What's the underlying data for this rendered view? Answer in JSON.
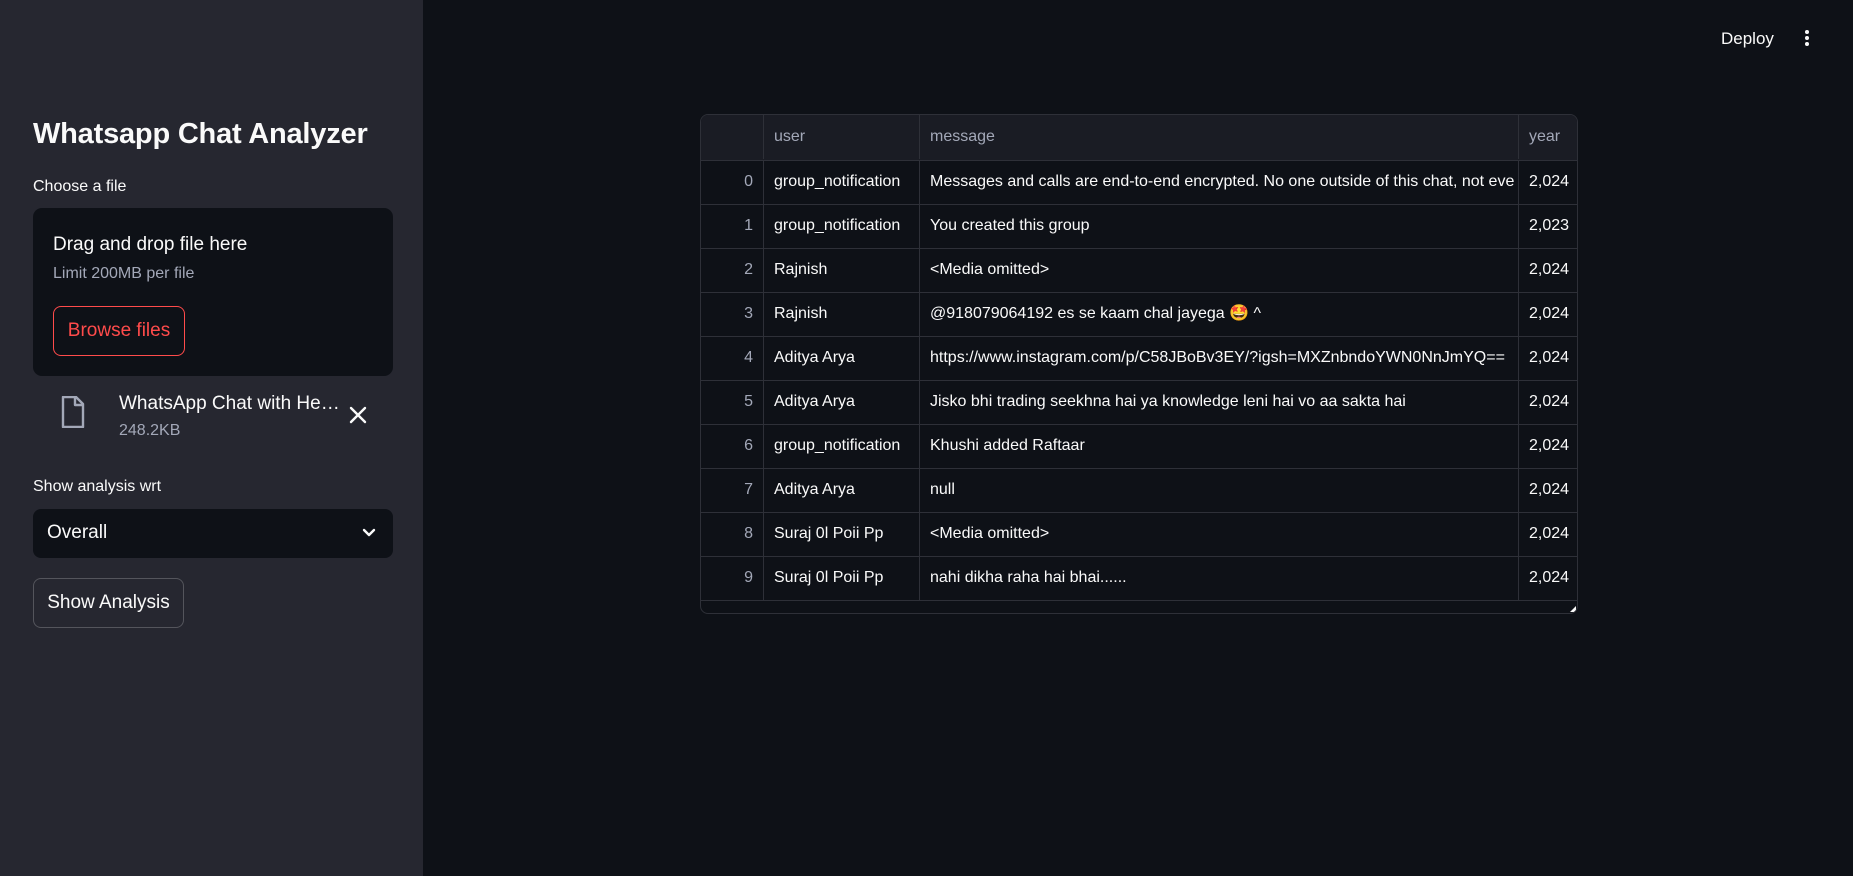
{
  "sidebar": {
    "title": "Whatsapp Chat Analyzer",
    "uploader": {
      "label": "Choose a file",
      "drop_title": "Drag and drop file here",
      "limit": "Limit 200MB per file",
      "browse_label": "Browse files"
    },
    "file": {
      "name": "WhatsApp Chat with Hehe.txt",
      "size": "248.2KB"
    },
    "select": {
      "label": "Show analysis wrt",
      "value": "Overall"
    },
    "show_button": "Show Analysis"
  },
  "header": {
    "deploy": "Deploy"
  },
  "table": {
    "columns": [
      "",
      "user",
      "message",
      "year"
    ],
    "rows": [
      {
        "index": "0",
        "user": "group_notification",
        "message": "Messages and calls are end-to-end encrypted. No one outside of this chat, not eve",
        "year": "2,024"
      },
      {
        "index": "1",
        "user": "group_notification",
        "message": "You created this group",
        "year": "2,023"
      },
      {
        "index": "2",
        "user": "Rajnish",
        "message": "<Media omitted>",
        "year": "2,024"
      },
      {
        "index": "3",
        "user": "Rajnish",
        "message": "@918079064192 es se kaam chal jayega 🤩 ^",
        "year": "2,024"
      },
      {
        "index": "4",
        "user": "Aditya Arya",
        "message": "https://www.instagram.com/p/C58JBoBv3EY/?igsh=MXZnbndoYWN0NnJmYQ==",
        "year": "2,024"
      },
      {
        "index": "5",
        "user": "Aditya Arya",
        "message": "Jisko bhi trading seekhna hai ya knowledge leni hai vo aa sakta hai",
        "year": "2,024"
      },
      {
        "index": "6",
        "user": "group_notification",
        "message": "Khushi added Raftaar",
        "year": "2,024"
      },
      {
        "index": "7",
        "user": "Aditya Arya",
        "message": "null",
        "year": "2,024"
      },
      {
        "index": "8",
        "user": "Suraj 0l Poii Pp",
        "message": "<Media omitted>",
        "year": "2,024"
      },
      {
        "index": "9",
        "user": "Suraj 0l Poii Pp",
        "message": "nahi dikha raha hai bhai......",
        "year": "2,024"
      }
    ]
  },
  "colors": {
    "background": "#0e1117",
    "sidebar": "#262730",
    "accent": "#ff4b4b"
  },
  "icons": {
    "file": "file-icon",
    "remove": "close-icon",
    "dropdown": "chevron-down-icon",
    "menu": "kebab-menu-icon"
  }
}
